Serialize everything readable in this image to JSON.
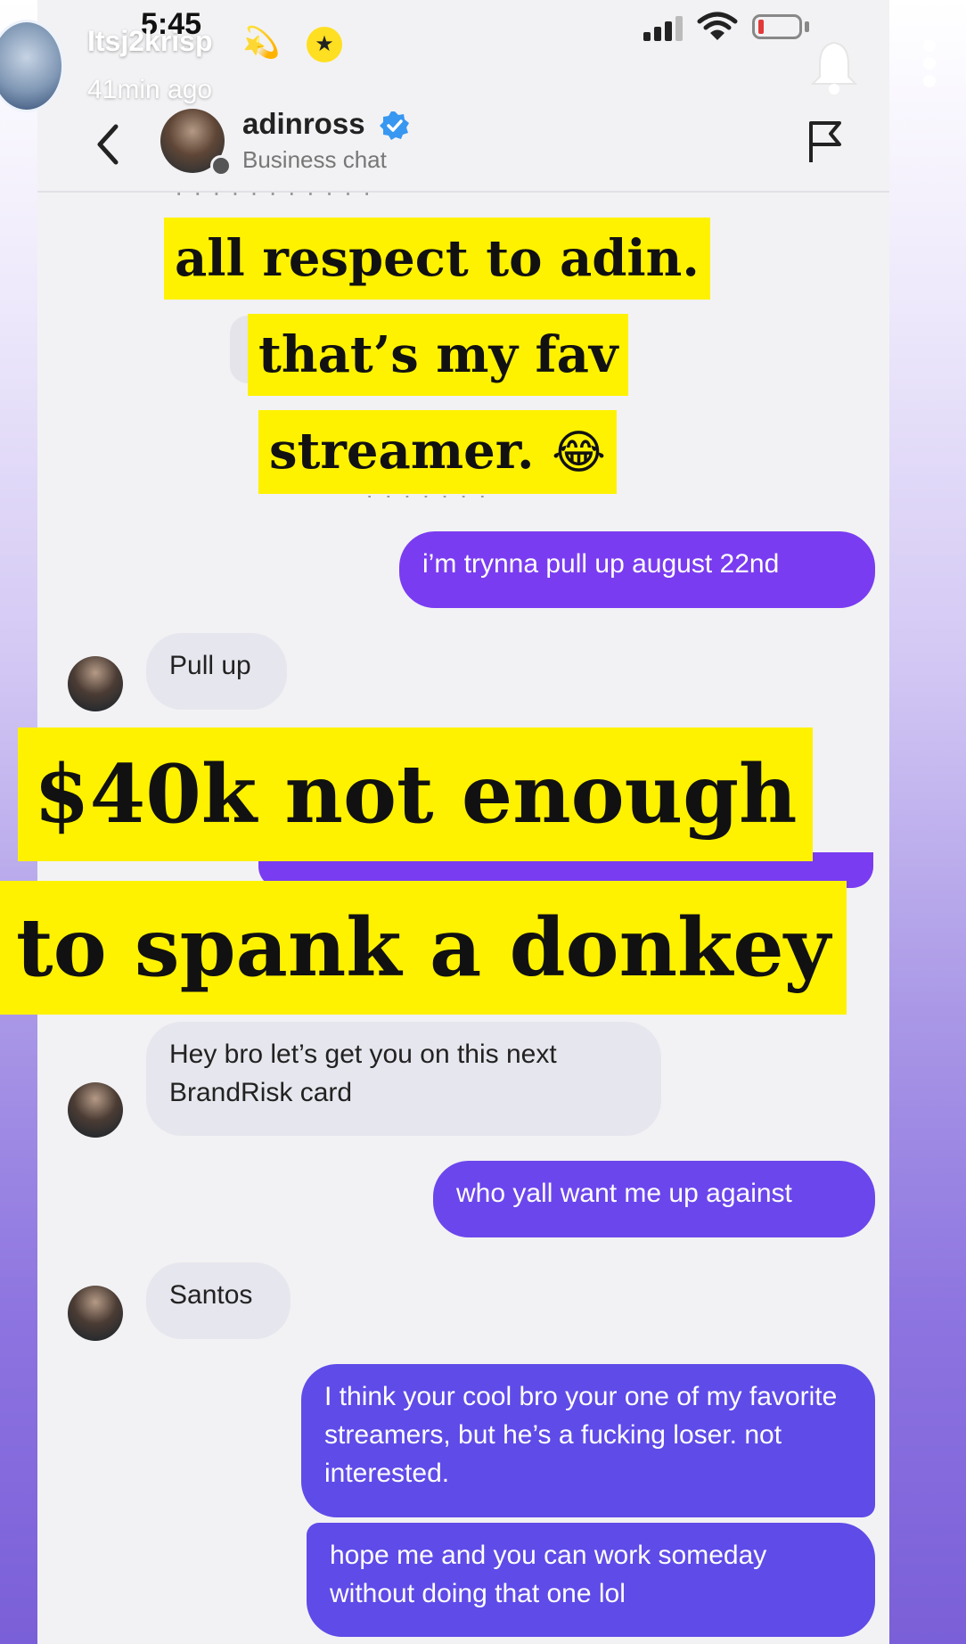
{
  "story": {
    "username": "Itsj2krisp",
    "username_emoji": "💫",
    "star_badge": "★",
    "posted_ago": "41min ago"
  },
  "status_bar": {
    "time": "5:45"
  },
  "chat_header": {
    "name": "adinross",
    "subtitle": "Business chat"
  },
  "captions": [
    "all respect to adin.",
    "that’s my fav",
    "streamer.",
    "$40k not enough",
    "to spank a donkey"
  ],
  "caption_emoji": "😂",
  "messages": [
    {
      "from": "me",
      "text": "i’m trynna pull up august 22nd"
    },
    {
      "from": "them",
      "text": "Pull up"
    },
    {
      "from": "them",
      "text": "Hey bro let’s get you on this next BrandRisk card"
    },
    {
      "from": "me",
      "text": "who yall want me up against"
    },
    {
      "from": "them",
      "text": "Santos"
    },
    {
      "from": "me",
      "text": "I think your cool bro your one of my favorite streamers, but he’s a fucking loser. not interested."
    },
    {
      "from": "me",
      "text": "hope me and you can work someday without doing that one lol"
    }
  ],
  "colors": {
    "accent_purple": "#7a3cf0",
    "caption_yellow": "#fff200",
    "incoming_bubble": "#e6e6ee",
    "verified_blue": "#3897f0"
  },
  "icons": [
    "back-chevron-icon",
    "verified-badge-icon",
    "flag-icon",
    "bell-icon",
    "more-options-icon",
    "signal-icon",
    "wifi-icon",
    "battery-icon"
  ]
}
